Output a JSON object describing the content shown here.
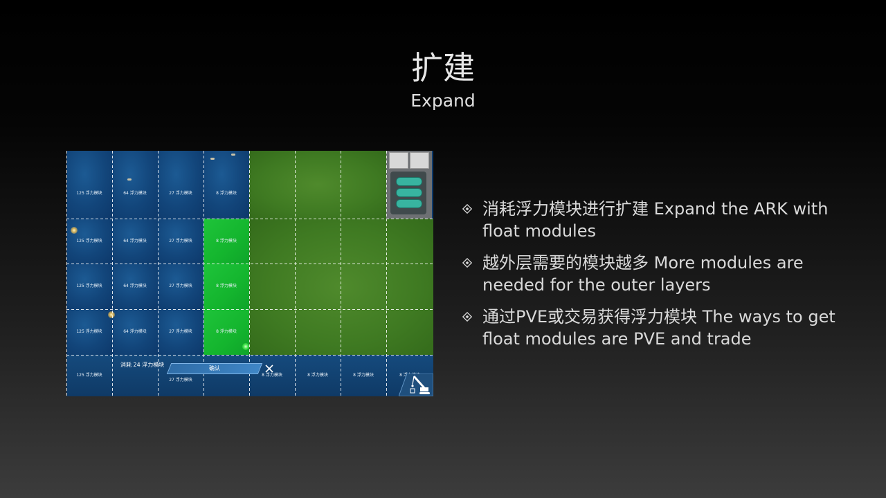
{
  "slide": {
    "title": "扩建",
    "subtitle": "Expand"
  },
  "game": {
    "rows": [
      [
        "125 浮力模块",
        "64 浮力模块",
        "27 浮力模块",
        "8 浮力模块"
      ],
      [
        "125 浮力模块",
        "64 浮力模块",
        "27 浮力模块",
        "8 浮力模块"
      ],
      [
        "125 浮力模块",
        "64 浮力模块",
        "27 浮力模块",
        "8 浮力模块"
      ],
      [
        "125 浮力模块",
        "64 浮力模块",
        "27 浮力模块",
        "8 浮力模块"
      ]
    ],
    "bottom_row": [
      "125 浮力模块",
      "",
      "27 浮力模块",
      "",
      "8 浮力模块",
      "8 浮力模块",
      "8 浮力模块",
      "8 浮力模块"
    ],
    "consume_text": "消耗 24 浮力模块",
    "confirm_label": "确认",
    "close_icon": "close-icon",
    "crane_icon": "crane-icon",
    "colors": {
      "water": "#12457a",
      "grass": "#3f7a22",
      "highlight": "#14b52e",
      "confirm": "#3f86c6"
    }
  },
  "bullets": [
    "消耗浮力模块进行扩建 Expand the ARK with float modules",
    "越外层需要的模块越多 More modules are needed for the outer layers",
    "通过PVE或交易获得浮力模块 The ways to get float modules are PVE  and trade"
  ],
  "bullet_icon": "diamond-bullet-icon"
}
